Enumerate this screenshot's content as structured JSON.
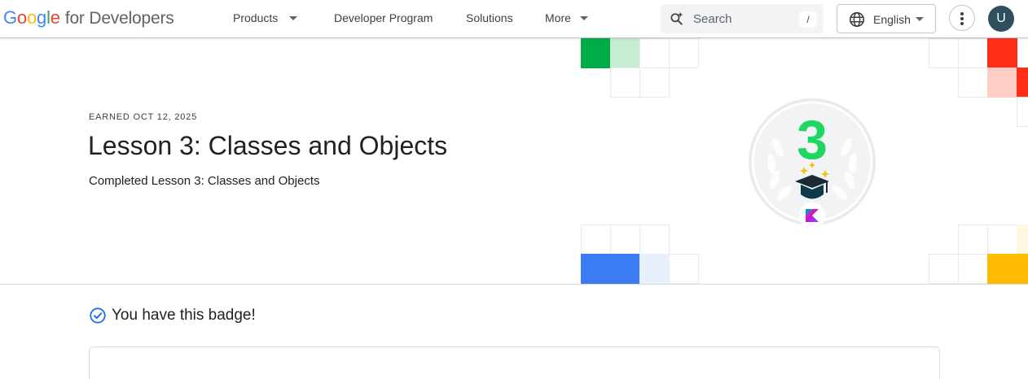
{
  "header": {
    "logo": {
      "google_letters": [
        {
          "char": "G",
          "color": "#4285f4"
        },
        {
          "char": "o",
          "color": "#ea4335"
        },
        {
          "char": "o",
          "color": "#fbbc04"
        },
        {
          "char": "g",
          "color": "#4285f4"
        },
        {
          "char": "l",
          "color": "#34a853"
        },
        {
          "char": "e",
          "color": "#ea4335"
        }
      ],
      "suffix": "for Developers"
    },
    "nav": [
      {
        "label": "Products",
        "has_menu": true
      },
      {
        "label": "Developer Program",
        "has_menu": false
      },
      {
        "label": "Solutions",
        "has_menu": false
      },
      {
        "label": "More",
        "has_menu": true
      }
    ],
    "search": {
      "placeholder": "Search",
      "shortcut": "/",
      "icon": "search-spark-icon"
    },
    "language": {
      "label": "English",
      "icon": "globe-icon"
    },
    "menu_icon": "more-vert-icon",
    "avatar_initial": "U"
  },
  "hero": {
    "earned": "EARNED OCT 12, 2025",
    "title": "Lesson 3: Classes and Objects",
    "subtitle": "Completed Lesson 3: Classes and Objects",
    "badge": {
      "number": "3",
      "number_color": "#1ed760",
      "emblem": "graduation-cap-icon",
      "product_icon": "kotlin-logo-icon"
    },
    "accent_colors": {
      "green": "#00ac47",
      "light_green": "#c8ecd3",
      "red": "#ff2d16",
      "light_red": "#ffcdc6",
      "blue": "#3b7cf5",
      "light_blue": "#e8f0fe",
      "yellow": "#ffbb00",
      "light_yellow": "#fff8e0"
    }
  },
  "status": {
    "text": "You have this badge!",
    "icon": "check-circle-icon",
    "color": "#1a73e8"
  }
}
